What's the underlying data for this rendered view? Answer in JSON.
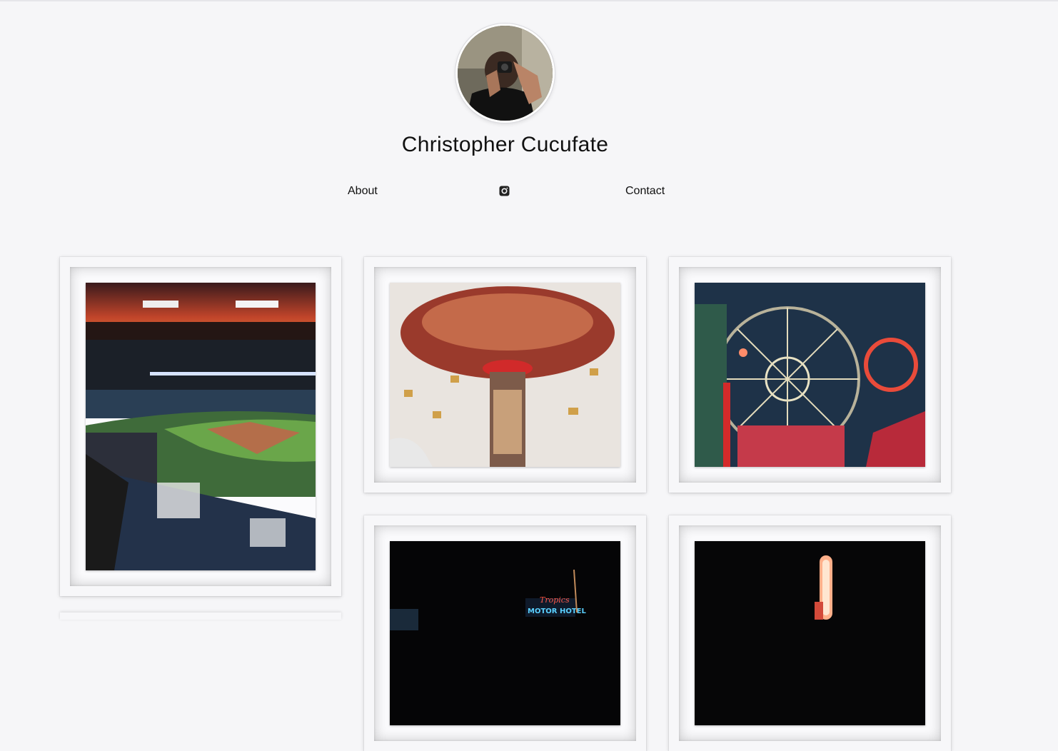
{
  "profile": {
    "name": "Christopher Cucufate",
    "avatar_icon": "photographer-with-camera-avatar"
  },
  "nav": {
    "about_label": "About",
    "instagram_icon": "instagram-icon",
    "contact_label": "Contact"
  },
  "gallery": {
    "photos": [
      {
        "subject": "baseball stadium at dusk",
        "icon": "stadium-photo"
      },
      {
        "subject": "swing carousel ride",
        "icon": "carousel-photo"
      },
      {
        "subject": "ferris wheel at night",
        "icon": "ferris-wheel-photo"
      },
      {
        "subject": "neon motel sign at night",
        "icon": "motel-sign-photo"
      },
      {
        "subject": "neon sign at night",
        "icon": "neon-sign-photo"
      }
    ],
    "motel_sign_text": "Tropics",
    "motel_sign_sub": "MOTOR HOTEL"
  },
  "colors": {
    "background": "#f6f6f8",
    "frame": "#f7f7f9",
    "text": "#111111"
  }
}
